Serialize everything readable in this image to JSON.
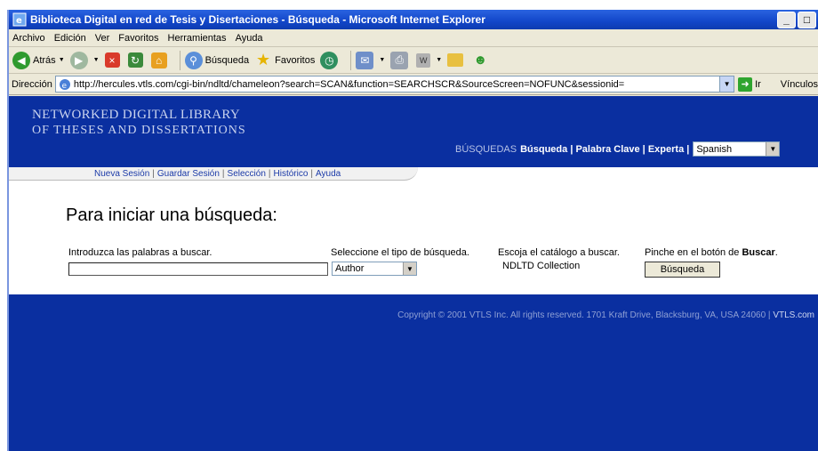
{
  "window": {
    "title": "Biblioteca Digital en red de Tesis y Disertaciones - Búsqueda - Microsoft Internet Explorer",
    "minimize": "_",
    "maximize": "□"
  },
  "menu": [
    "Archivo",
    "Edición",
    "Ver",
    "Favoritos",
    "Herramientas",
    "Ayuda"
  ],
  "toolbar": {
    "back": "Atrás",
    "search": "Búsqueda",
    "favorites": "Favoritos"
  },
  "address": {
    "label": "Dirección",
    "url": "http://hercules.vtls.com/cgi-bin/ndltd/chameleon?search=SCAN&function=SEARCHSCR&SourceScreen=NOFUNC&sessionid=",
    "go": "Ir",
    "links": "Vínculos"
  },
  "banner": {
    "logo_line1": "NETWORKED DIGITAL LIBRARY",
    "logo_line2": "OF THESES AND DISSERTATIONS",
    "search_caption": "BÚSQUEDAS",
    "search_basic": "Búsqueda",
    "search_keyword": "Palabra Clave",
    "search_expert": "Experta",
    "language": "Spanish"
  },
  "subnav": [
    "Nueva Sesión",
    "Guardar Sesión",
    "Selección",
    "Histórico",
    "Ayuda"
  ],
  "form": {
    "heading": "Para iniciar una búsqueda:",
    "keywords_label": "Introduzca las palabras a buscar.",
    "keywords_value": "",
    "type_label": "Seleccione el tipo de búsqueda.",
    "type_value": "Author",
    "catalog_label": "Escoja el catálogo a buscar.",
    "catalog_value": "NDLTD Collection",
    "button_hint_prefix": "Pinche en el botón de",
    "button_hint_bold": "Buscar",
    "button_hint_suffix": ".",
    "search_button": "Búsqueda"
  },
  "footer": {
    "copyright": "Copyright © 2001 VTLS Inc. All rights reserved. 1701 Kraft Drive, Blacksburg, VA, USA 24060 |",
    "vtls_link": "VTLS.com"
  }
}
